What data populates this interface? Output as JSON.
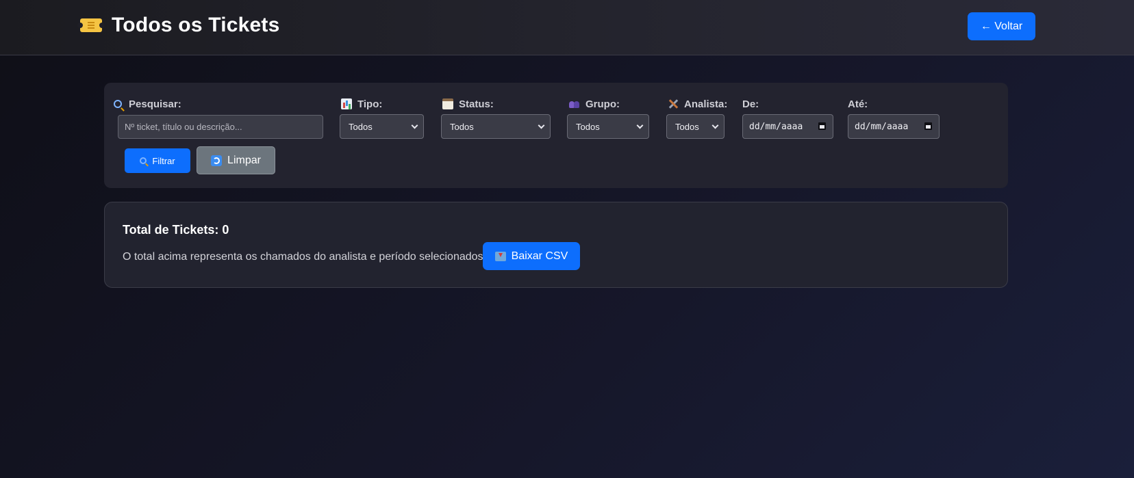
{
  "header": {
    "title": "Todos os Tickets",
    "title_icon": "ticket-icon",
    "back_label": "← Voltar"
  },
  "filters": {
    "search": {
      "label": "Pesquisar:",
      "icon": "search-icon",
      "placeholder": "Nº ticket, título ou descrição...",
      "value": ""
    },
    "tipo": {
      "label": "Tipo:",
      "icon": "bar-chart-icon",
      "selected": "Todos"
    },
    "status": {
      "label": "Status:",
      "icon": "clipboard-icon",
      "selected": "Todos"
    },
    "grupo": {
      "label": "Grupo:",
      "icon": "group-icon",
      "selected": "Todos"
    },
    "analista": {
      "label": "Analista:",
      "icon": "tools-icon",
      "selected": "Todos"
    },
    "de": {
      "label": "De:",
      "value": "dd/mm/aaaa"
    },
    "ate": {
      "label": "Até:",
      "value": "dd/mm/aaaa"
    },
    "filter_label": "Filtrar",
    "clear_label": "Limpar"
  },
  "summary": {
    "total_label": "Total de Tickets: 0",
    "description": "O total acima representa os chamados do analista e período selecionados.",
    "csv_label": "Baixar CSV"
  },
  "colors": {
    "accent": "#0d6efd",
    "secondary": "#6c757d",
    "panel": "#23232f"
  }
}
